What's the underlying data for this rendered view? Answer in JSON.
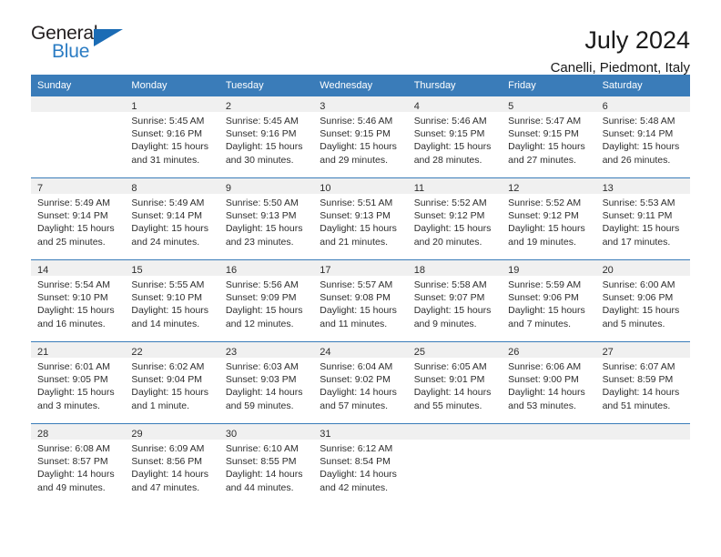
{
  "brand": {
    "name_top": "General",
    "name_bottom": "Blue",
    "accent_color": "#2b7cc3"
  },
  "header": {
    "title": "July 2024",
    "subtitle": "Canelli, Piedmont, Italy"
  },
  "calendar": {
    "header_color": "#3a7cb9",
    "weekdays": [
      "Sunday",
      "Monday",
      "Tuesday",
      "Wednesday",
      "Thursday",
      "Friday",
      "Saturday"
    ],
    "weeks": [
      [
        {
          "day": ""
        },
        {
          "day": "1",
          "sunrise": "Sunrise: 5:45 AM",
          "sunset": "Sunset: 9:16 PM",
          "daylight1": "Daylight: 15 hours",
          "daylight2": "and 31 minutes."
        },
        {
          "day": "2",
          "sunrise": "Sunrise: 5:45 AM",
          "sunset": "Sunset: 9:16 PM",
          "daylight1": "Daylight: 15 hours",
          "daylight2": "and 30 minutes."
        },
        {
          "day": "3",
          "sunrise": "Sunrise: 5:46 AM",
          "sunset": "Sunset: 9:15 PM",
          "daylight1": "Daylight: 15 hours",
          "daylight2": "and 29 minutes."
        },
        {
          "day": "4",
          "sunrise": "Sunrise: 5:46 AM",
          "sunset": "Sunset: 9:15 PM",
          "daylight1": "Daylight: 15 hours",
          "daylight2": "and 28 minutes."
        },
        {
          "day": "5",
          "sunrise": "Sunrise: 5:47 AM",
          "sunset": "Sunset: 9:15 PM",
          "daylight1": "Daylight: 15 hours",
          "daylight2": "and 27 minutes."
        },
        {
          "day": "6",
          "sunrise": "Sunrise: 5:48 AM",
          "sunset": "Sunset: 9:14 PM",
          "daylight1": "Daylight: 15 hours",
          "daylight2": "and 26 minutes."
        }
      ],
      [
        {
          "day": "7",
          "sunrise": "Sunrise: 5:49 AM",
          "sunset": "Sunset: 9:14 PM",
          "daylight1": "Daylight: 15 hours",
          "daylight2": "and 25 minutes."
        },
        {
          "day": "8",
          "sunrise": "Sunrise: 5:49 AM",
          "sunset": "Sunset: 9:14 PM",
          "daylight1": "Daylight: 15 hours",
          "daylight2": "and 24 minutes."
        },
        {
          "day": "9",
          "sunrise": "Sunrise: 5:50 AM",
          "sunset": "Sunset: 9:13 PM",
          "daylight1": "Daylight: 15 hours",
          "daylight2": "and 23 minutes."
        },
        {
          "day": "10",
          "sunrise": "Sunrise: 5:51 AM",
          "sunset": "Sunset: 9:13 PM",
          "daylight1": "Daylight: 15 hours",
          "daylight2": "and 21 minutes."
        },
        {
          "day": "11",
          "sunrise": "Sunrise: 5:52 AM",
          "sunset": "Sunset: 9:12 PM",
          "daylight1": "Daylight: 15 hours",
          "daylight2": "and 20 minutes."
        },
        {
          "day": "12",
          "sunrise": "Sunrise: 5:52 AM",
          "sunset": "Sunset: 9:12 PM",
          "daylight1": "Daylight: 15 hours",
          "daylight2": "and 19 minutes."
        },
        {
          "day": "13",
          "sunrise": "Sunrise: 5:53 AM",
          "sunset": "Sunset: 9:11 PM",
          "daylight1": "Daylight: 15 hours",
          "daylight2": "and 17 minutes."
        }
      ],
      [
        {
          "day": "14",
          "sunrise": "Sunrise: 5:54 AM",
          "sunset": "Sunset: 9:10 PM",
          "daylight1": "Daylight: 15 hours",
          "daylight2": "and 16 minutes."
        },
        {
          "day": "15",
          "sunrise": "Sunrise: 5:55 AM",
          "sunset": "Sunset: 9:10 PM",
          "daylight1": "Daylight: 15 hours",
          "daylight2": "and 14 minutes."
        },
        {
          "day": "16",
          "sunrise": "Sunrise: 5:56 AM",
          "sunset": "Sunset: 9:09 PM",
          "daylight1": "Daylight: 15 hours",
          "daylight2": "and 12 minutes."
        },
        {
          "day": "17",
          "sunrise": "Sunrise: 5:57 AM",
          "sunset": "Sunset: 9:08 PM",
          "daylight1": "Daylight: 15 hours",
          "daylight2": "and 11 minutes."
        },
        {
          "day": "18",
          "sunrise": "Sunrise: 5:58 AM",
          "sunset": "Sunset: 9:07 PM",
          "daylight1": "Daylight: 15 hours",
          "daylight2": "and 9 minutes."
        },
        {
          "day": "19",
          "sunrise": "Sunrise: 5:59 AM",
          "sunset": "Sunset: 9:06 PM",
          "daylight1": "Daylight: 15 hours",
          "daylight2": "and 7 minutes."
        },
        {
          "day": "20",
          "sunrise": "Sunrise: 6:00 AM",
          "sunset": "Sunset: 9:06 PM",
          "daylight1": "Daylight: 15 hours",
          "daylight2": "and 5 minutes."
        }
      ],
      [
        {
          "day": "21",
          "sunrise": "Sunrise: 6:01 AM",
          "sunset": "Sunset: 9:05 PM",
          "daylight1": "Daylight: 15 hours",
          "daylight2": "and 3 minutes."
        },
        {
          "day": "22",
          "sunrise": "Sunrise: 6:02 AM",
          "sunset": "Sunset: 9:04 PM",
          "daylight1": "Daylight: 15 hours",
          "daylight2": "and 1 minute."
        },
        {
          "day": "23",
          "sunrise": "Sunrise: 6:03 AM",
          "sunset": "Sunset: 9:03 PM",
          "daylight1": "Daylight: 14 hours",
          "daylight2": "and 59 minutes."
        },
        {
          "day": "24",
          "sunrise": "Sunrise: 6:04 AM",
          "sunset": "Sunset: 9:02 PM",
          "daylight1": "Daylight: 14 hours",
          "daylight2": "and 57 minutes."
        },
        {
          "day": "25",
          "sunrise": "Sunrise: 6:05 AM",
          "sunset": "Sunset: 9:01 PM",
          "daylight1": "Daylight: 14 hours",
          "daylight2": "and 55 minutes."
        },
        {
          "day": "26",
          "sunrise": "Sunrise: 6:06 AM",
          "sunset": "Sunset: 9:00 PM",
          "daylight1": "Daylight: 14 hours",
          "daylight2": "and 53 minutes."
        },
        {
          "day": "27",
          "sunrise": "Sunrise: 6:07 AM",
          "sunset": "Sunset: 8:59 PM",
          "daylight1": "Daylight: 14 hours",
          "daylight2": "and 51 minutes."
        }
      ],
      [
        {
          "day": "28",
          "sunrise": "Sunrise: 6:08 AM",
          "sunset": "Sunset: 8:57 PM",
          "daylight1": "Daylight: 14 hours",
          "daylight2": "and 49 minutes."
        },
        {
          "day": "29",
          "sunrise": "Sunrise: 6:09 AM",
          "sunset": "Sunset: 8:56 PM",
          "daylight1": "Daylight: 14 hours",
          "daylight2": "and 47 minutes."
        },
        {
          "day": "30",
          "sunrise": "Sunrise: 6:10 AM",
          "sunset": "Sunset: 8:55 PM",
          "daylight1": "Daylight: 14 hours",
          "daylight2": "and 44 minutes."
        },
        {
          "day": "31",
          "sunrise": "Sunrise: 6:12 AM",
          "sunset": "Sunset: 8:54 PM",
          "daylight1": "Daylight: 14 hours",
          "daylight2": "and 42 minutes."
        },
        {
          "day": ""
        },
        {
          "day": ""
        },
        {
          "day": ""
        }
      ]
    ]
  }
}
